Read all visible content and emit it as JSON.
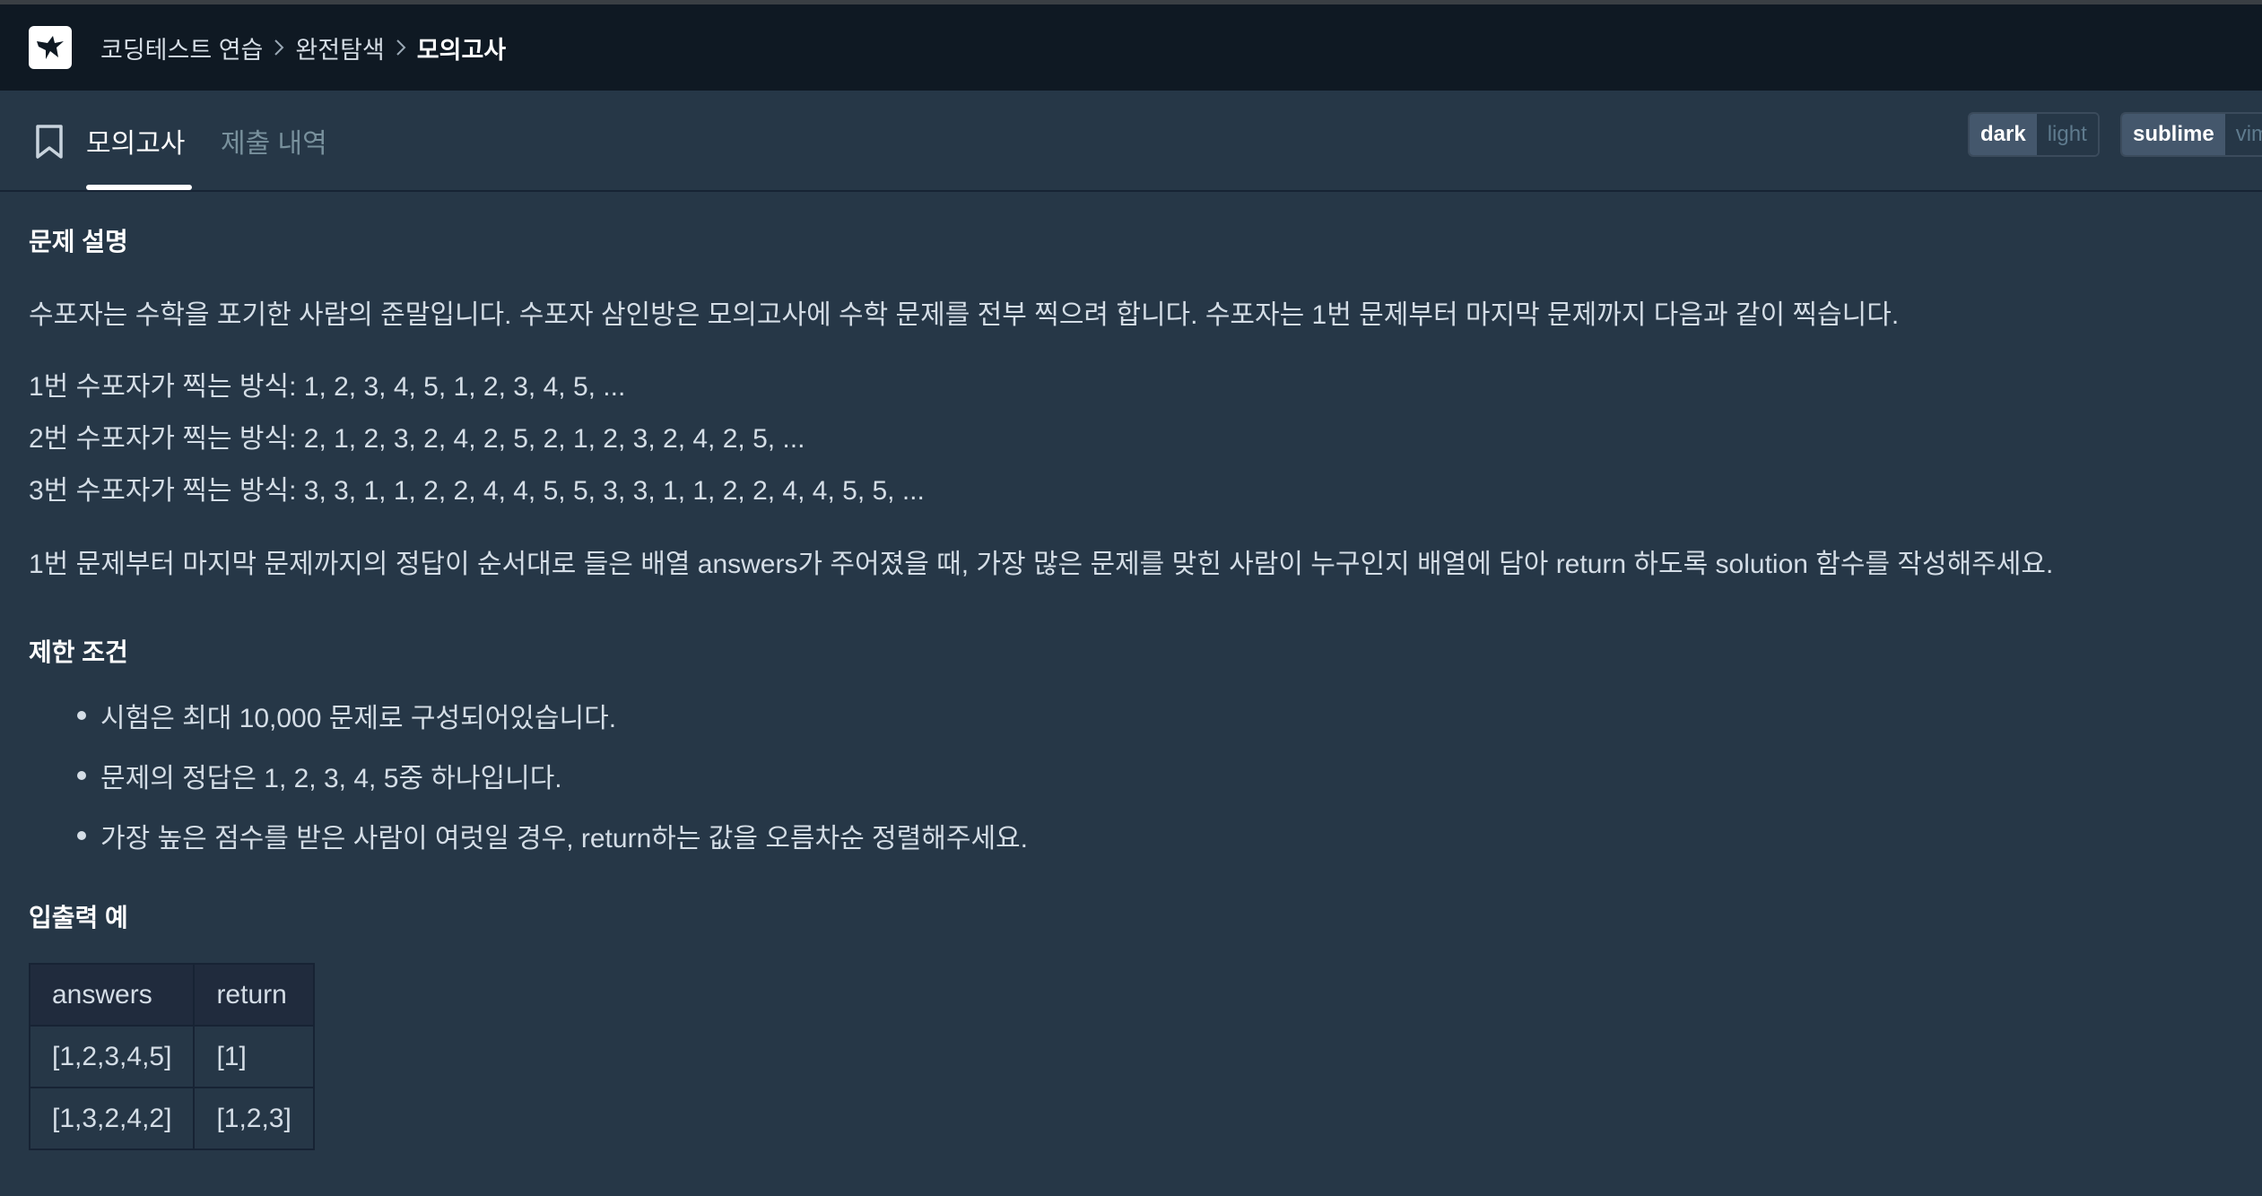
{
  "nav": {
    "breadcrumb": [
      "코딩테스트 연습",
      "완전탐색",
      "모의고사"
    ]
  },
  "tabs": {
    "active": "모의고사",
    "inactive": "제출 내역"
  },
  "theme_toggle": {
    "dark": "dark",
    "light": "light"
  },
  "editor_toggle": {
    "sublime": "sublime",
    "vim": "vim"
  },
  "problem": {
    "desc_title": "문제 설명",
    "intro": "수포자는 수학을 포기한 사람의 준말입니다. 수포자 삼인방은 모의고사에 수학 문제를 전부 찍으려 합니다. 수포자는 1번 문제부터 마지막 문제까지 다음과 같이 찍습니다.",
    "patterns": [
      "1번 수포자가 찍는 방식: 1, 2, 3, 4, 5, 1, 2, 3, 4, 5, ...",
      "2번 수포자가 찍는 방식: 2, 1, 2, 3, 2, 4, 2, 5, 2, 1, 2, 3, 2, 4, 2, 5, ...",
      "3번 수포자가 찍는 방식: 3, 3, 1, 1, 2, 2, 4, 4, 5, 5, 3, 3, 1, 1, 2, 2, 4, 4, 5, 5, ..."
    ],
    "task": "1번 문제부터 마지막 문제까지의 정답이 순서대로 들은 배열 answers가 주어졌을 때, 가장 많은 문제를 맞힌 사람이 누구인지 배열에 담아 return 하도록 solution 함수를 작성해주세요.",
    "constraints_title": "제한 조건",
    "constraints": [
      "시험은 최대 10,000 문제로 구성되어있습니다.",
      "문제의 정답은 1, 2, 3, 4, 5중 하나입니다.",
      "가장 높은 점수를 받은 사람이 여럿일 경우, return하는 값을 오름차순 정렬해주세요."
    ],
    "io_title": "입출력 예",
    "io_table": {
      "headers": [
        "answers",
        "return"
      ],
      "rows": [
        [
          "[1,2,3,4,5]",
          "[1]"
        ],
        [
          "[1,3,2,4,2]",
          "[1,2,3]"
        ]
      ]
    }
  },
  "colors": {
    "background": "#263747",
    "navbar": "#0f1923",
    "text": "#d4dde6",
    "inactive_tab": "#78909c"
  }
}
